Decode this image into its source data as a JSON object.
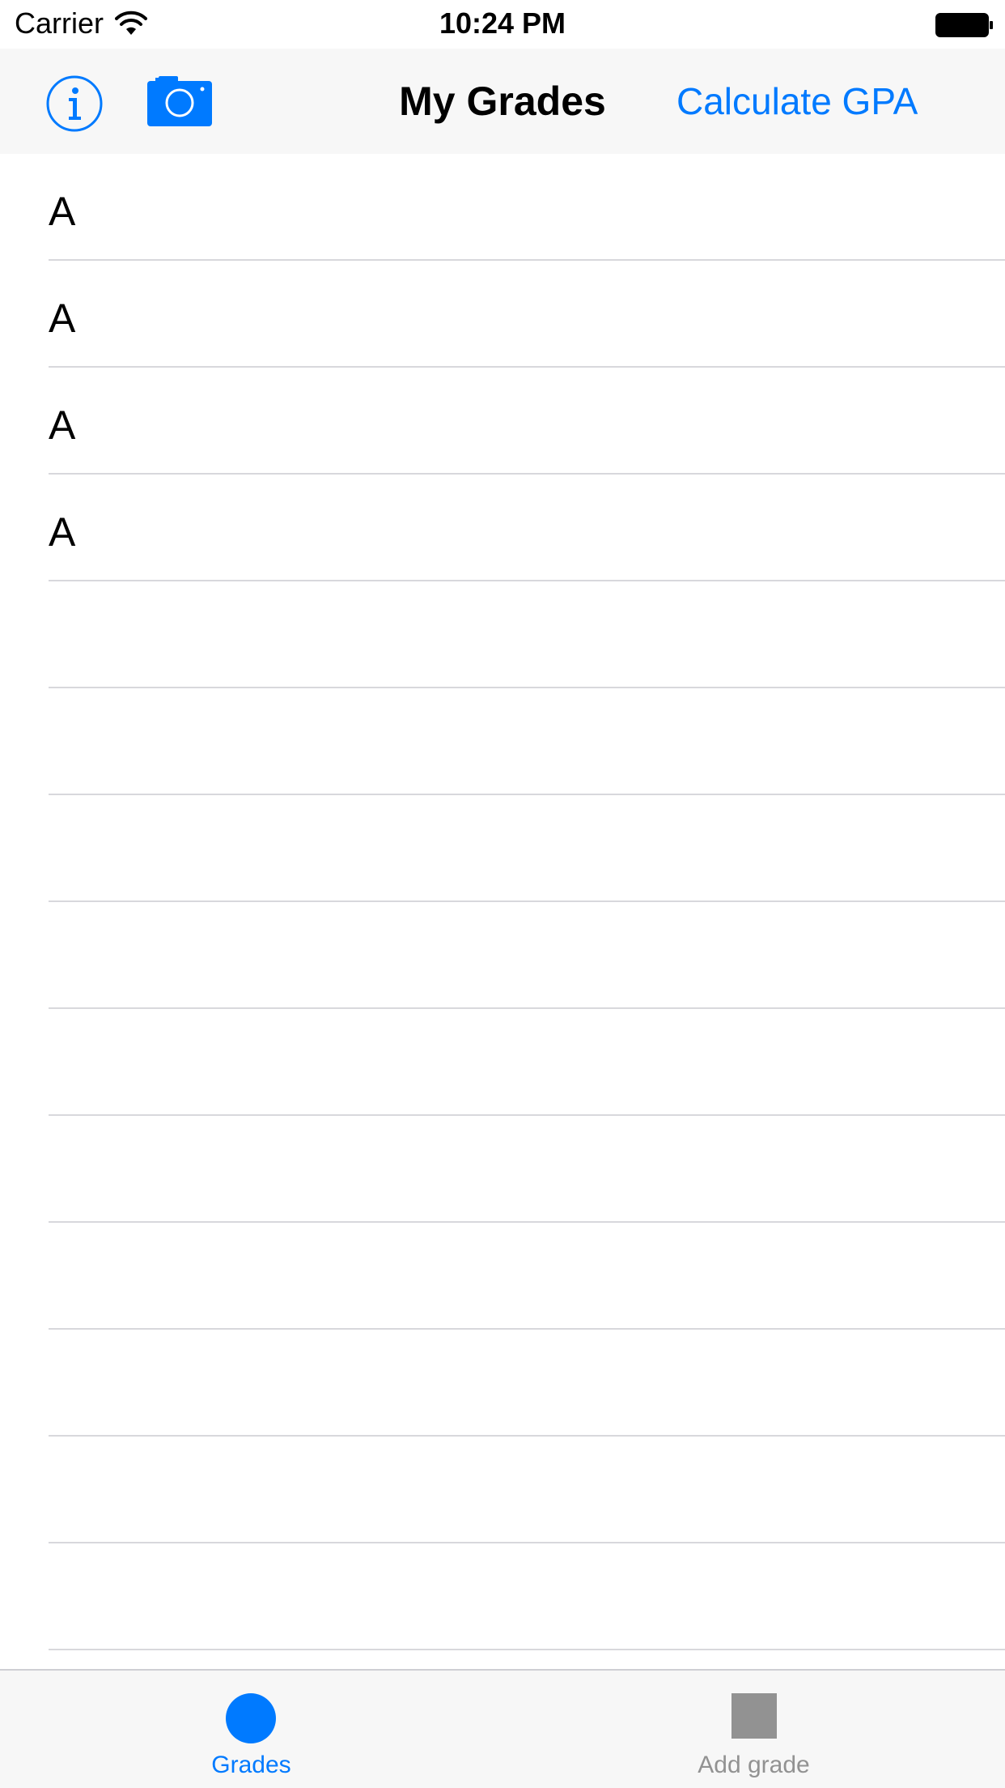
{
  "status_bar": {
    "carrier": "Carrier",
    "time": "10:24 PM",
    "wifi_icon": "wifi-icon",
    "battery_icon": "battery-full-icon"
  },
  "nav_bar": {
    "title": "My Grades",
    "info_icon": "info-circle-icon",
    "camera_icon": "camera-icon",
    "action_label": "Calculate GPA"
  },
  "grades": {
    "rows": [
      "A",
      "A",
      "A",
      "A",
      "",
      "",
      "",
      "",
      "",
      "",
      "",
      "",
      "",
      "",
      ""
    ]
  },
  "tab_bar": {
    "tabs": [
      {
        "label": "Grades",
        "icon": "circle-icon",
        "selected": true
      },
      {
        "label": "Add grade",
        "icon": "square-icon",
        "selected": false
      }
    ]
  },
  "colors": {
    "accent": "#007aff",
    "inactive": "#929292",
    "bar_background": "#f7f7f7",
    "separator": "#d8d8dc"
  }
}
